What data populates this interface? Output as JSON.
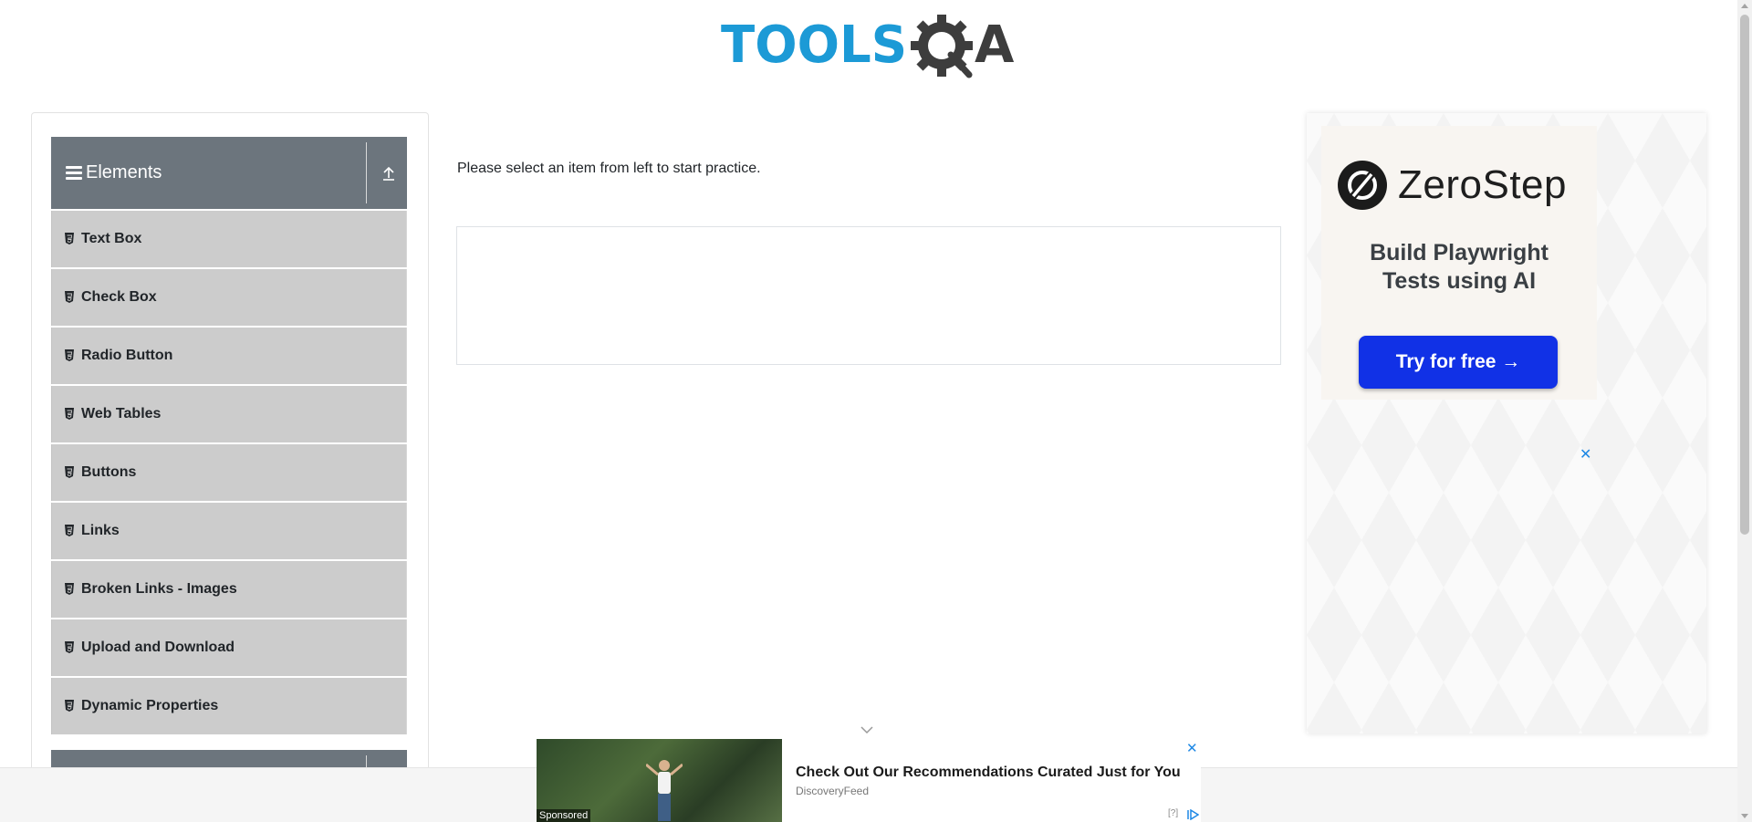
{
  "header": {
    "logo_text": "TOOLSQA"
  },
  "sidebar": {
    "group_title": "Elements",
    "items": [
      {
        "label": "Text Box"
      },
      {
        "label": "Check Box"
      },
      {
        "label": "Radio Button"
      },
      {
        "label": "Web Tables"
      },
      {
        "label": "Buttons"
      },
      {
        "label": "Links"
      },
      {
        "label": "Broken Links - Images"
      },
      {
        "label": "Upload and Download"
      },
      {
        "label": "Dynamic Properties"
      }
    ]
  },
  "main": {
    "instruction": "Please select an item from left to start practice."
  },
  "ad_right": {
    "brand": "ZeroStep",
    "tagline_line1": "Build Playwright",
    "tagline_line2": "Tests using AI",
    "cta": "Try for free →",
    "close": "✕"
  },
  "ad_bottom": {
    "headline": "Check Out Our Recommendations Curated Just for You",
    "source": "DiscoveryFeed",
    "sponsored": "Sponsored",
    "info": "[?]",
    "close": "✕"
  },
  "colors": {
    "logo_blue": "#1c9ad6",
    "logo_dark": "#3d3d3d",
    "group_header": "#6c757d",
    "menu_item": "#cccccc",
    "cta_blue": "#1131e6"
  }
}
